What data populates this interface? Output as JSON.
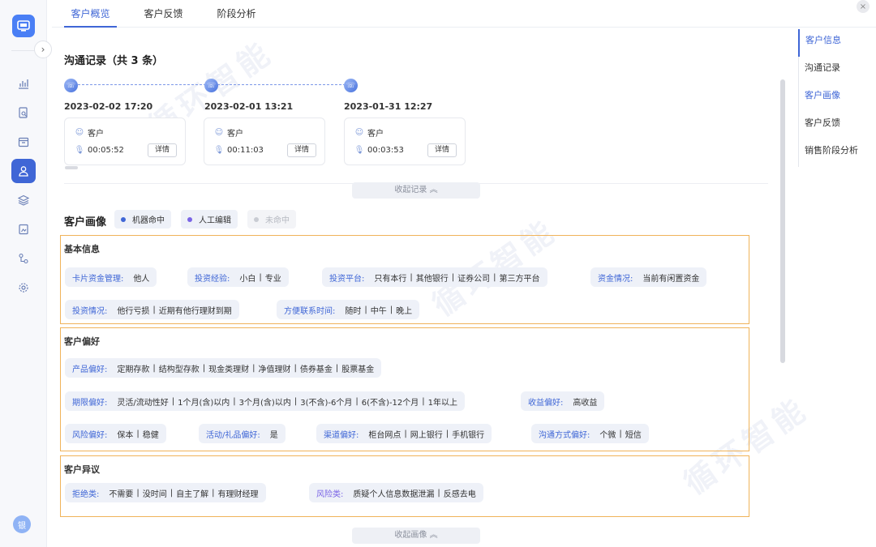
{
  "tabs": [
    {
      "label": "客户概览",
      "active": true
    },
    {
      "label": "客户反馈",
      "active": false
    },
    {
      "label": "阶段分析",
      "active": false
    }
  ],
  "rail": {
    "avatar_text": "银"
  },
  "right_nav": [
    {
      "label": "客户信息",
      "active": true
    },
    {
      "label": "沟通记录",
      "active": false
    },
    {
      "label": "客户画像",
      "active": true
    },
    {
      "label": "客户反馈",
      "active": false
    },
    {
      "label": "销售阶段分析",
      "active": false
    }
  ],
  "records": {
    "title": "沟通记录（共 3 条）",
    "items": [
      {
        "date": "2023-02-02 17:20",
        "role": "客户",
        "duration": "00:05:52",
        "detail": "详情"
      },
      {
        "date": "2023-02-01 13:21",
        "role": "客户",
        "duration": "00:11:03",
        "detail": "详情"
      },
      {
        "date": "2023-01-31 12:27",
        "role": "客户",
        "duration": "00:03:53",
        "detail": "详情"
      }
    ],
    "collapse_label": "收起记录 ︽"
  },
  "portrait": {
    "title": "客户画像",
    "legend": [
      {
        "label": "机器命中",
        "color": "#3f66d6"
      },
      {
        "label": "人工编辑",
        "color": "#7a64e6"
      },
      {
        "label": "未命中",
        "color": "#c9ccd3"
      }
    ],
    "collapse_label": "收起画像 ︽"
  },
  "sections": {
    "basic": {
      "title": "基本信息",
      "chips": [
        {
          "key": "卡片资金管理:",
          "values": [
            "他人"
          ]
        },
        {
          "key": "投资经验:",
          "values": [
            "小白",
            "专业"
          ]
        },
        {
          "key": "投资平台:",
          "values": [
            "只有本行",
            "其他银行",
            "证券公司",
            "第三方平台"
          ]
        },
        {
          "key": "资金情况:",
          "values": [
            "当前有闲置资金"
          ]
        },
        {
          "key": "投资情况:",
          "values": [
            "他行亏损",
            "近期有他行理财到期"
          ]
        },
        {
          "key": "方便联系时间:",
          "values": [
            "随时",
            "中午",
            "晚上"
          ]
        }
      ]
    },
    "pref": {
      "title": "客户偏好",
      "chips": [
        {
          "key": "产品偏好:",
          "values": [
            "定期存款",
            "结构型存款",
            "现金类理财",
            "净值理财",
            "债券基金",
            "股票基金"
          ]
        },
        {
          "key": "期限偏好:",
          "values": [
            "灵活/流动性好",
            "1个月(含)以内",
            "3个月(含)以内",
            "3(不含)-6个月",
            "6(不含)-12个月",
            "1年以上"
          ]
        },
        {
          "key": "收益偏好:",
          "values": [
            "高收益"
          ]
        },
        {
          "key": "风险偏好:",
          "values": [
            "保本",
            "稳健"
          ]
        },
        {
          "key": "活动/礼品偏好:",
          "values": [
            "是"
          ]
        },
        {
          "key": "渠道偏好:",
          "values": [
            "柜台网点",
            "网上银行",
            "手机银行"
          ]
        },
        {
          "key": "沟通方式偏好:",
          "values": [
            "个微",
            "短信"
          ]
        }
      ]
    },
    "objection": {
      "title": "客户异议",
      "chips": [
        {
          "key": "拒绝类:",
          "values": [
            "不需要",
            "没时间",
            "自主了解",
            "有理财经理"
          ]
        },
        {
          "key": "风险类:",
          "values": [
            "质疑个人信息数据泄漏",
            "反感去电"
          ],
          "key_color": "#7a64e6"
        }
      ]
    }
  },
  "watermark": "循环智能"
}
